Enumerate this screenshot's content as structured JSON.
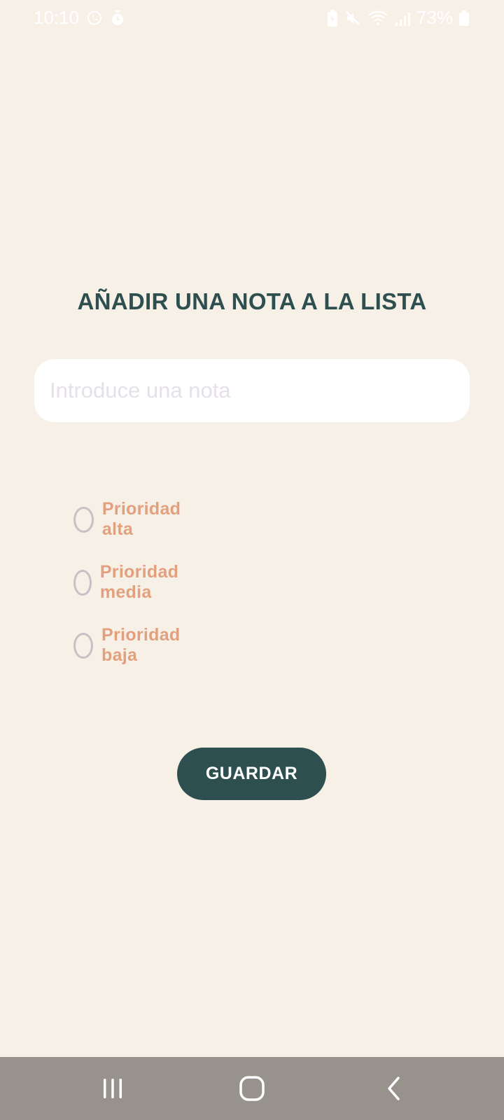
{
  "status_bar": {
    "time": "10:10",
    "battery_percent": "73%",
    "left_icons": [
      "whatsapp-icon",
      "timer-icon"
    ],
    "right_icons": [
      "battery-saver-icon",
      "mute-icon",
      "wifi-icon",
      "signal-icon",
      "battery-icon"
    ]
  },
  "screen": {
    "title": "AÑADIR UNA NOTA A LA LISTA",
    "note_input": {
      "value": "",
      "placeholder": "Introduce una nota"
    },
    "priority_options": [
      {
        "label": "Prioridad alta",
        "selected": false
      },
      {
        "label": "Prioridad media",
        "selected": false
      },
      {
        "label": "Prioridad baja",
        "selected": false
      }
    ],
    "save_label": "GUARDAR"
  },
  "nav_bar": {
    "buttons": [
      "recent-apps-icon",
      "home-icon",
      "back-icon"
    ]
  },
  "colors": {
    "background": "#f7f0e6",
    "primary": "#2e4f4f",
    "accent": "#e3a07e",
    "radio_border": "#c5c1c6",
    "nav_bar": "#97938c"
  }
}
